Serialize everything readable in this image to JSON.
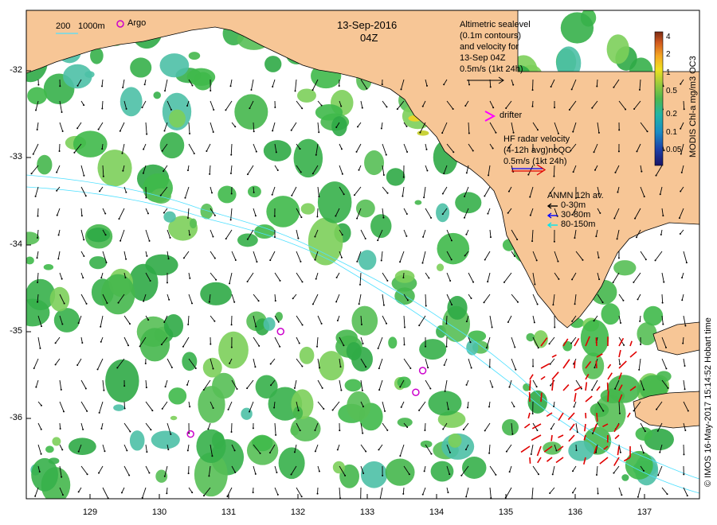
{
  "title": {
    "date": "13-Sep-2016",
    "time": "04Z"
  },
  "isobath_label": {
    "depth_200": "200",
    "depth_1000": "1000m"
  },
  "argo_label": "Argo",
  "altimetry": {
    "line1": "Altimetric sealevel",
    "line2": "(0.1m contours)",
    "line3": "and velocity for",
    "line4": "13-Sep 04Z",
    "line5": "0.5m/s (1kt 24h)"
  },
  "drifter_label": "drifter",
  "hf_radar": {
    "line1": "HF radar velocity",
    "line2": "(4-12h avg)noQC",
    "line3": "0.5m/s (1kt 24h)"
  },
  "anmn": {
    "title": "ANMN 12h av.",
    "items": [
      {
        "label": "0-30m",
        "color": "#000000"
      },
      {
        "label": "30-80m",
        "color": "#0000ff"
      },
      {
        "label": "80-150m",
        "color": "#00e5ee"
      }
    ]
  },
  "colorbar": {
    "label": "MODIS Chl-a mg/m3 OC3",
    "ticks": [
      "4",
      "2",
      "1",
      "0.5",
      "0.2",
      "0.1",
      "0.05"
    ]
  },
  "credit": "© IMOS 16-May-2017 15:14:52 Hobart time",
  "axes": {
    "x_ticks": [
      "129",
      "130",
      "131",
      "132",
      "133",
      "134",
      "135",
      "136",
      "137"
    ],
    "y_ticks": [
      "-32",
      "-33",
      "-34",
      "-35",
      "-36"
    ]
  },
  "colors": {
    "land": "#f7c696",
    "chl_green": "#3fb94a",
    "chl_teal": "#4cc0a6",
    "hf_radar": "#e00000",
    "argo": "#cc00cc",
    "isobath": "#4fe0ff"
  },
  "argo_floats": [
    {
      "lon": 131.75,
      "lat": -35.0
    },
    {
      "lon": 133.8,
      "lat": -35.45
    },
    {
      "lon": 133.7,
      "lat": -35.7
    },
    {
      "lon": 130.45,
      "lat": -36.18
    }
  ]
}
